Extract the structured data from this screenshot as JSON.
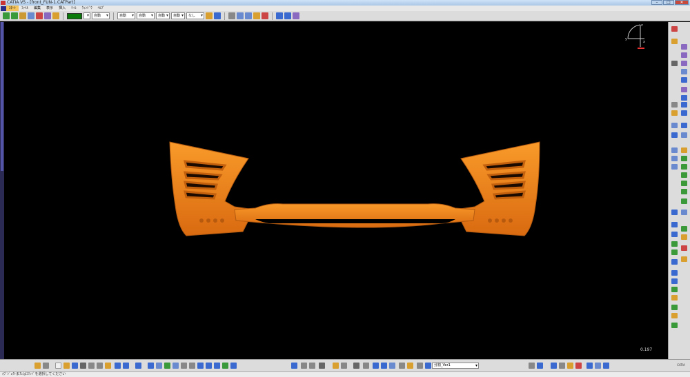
{
  "window": {
    "title": "CATIA V5 - [front_FUN-1.CATPart]",
    "controls": {
      "minimize": "–",
      "maximize": "□",
      "close": "✕"
    }
  },
  "menubar": {
    "items": [
      "ｽﾀｰﾄ",
      "ﾌｧｲﾙ",
      "編集",
      "表示",
      "挿入",
      "ﾂｰﾙ",
      "ｳｨﾝﾄﾞｳ",
      "ﾍﾙﾌﾟ"
    ]
  },
  "toolbar_top": {
    "color": "#0a7a0a",
    "combos": [
      "",
      "自動",
      "自動",
      "自動",
      "自動",
      "自動",
      "なし"
    ]
  },
  "viewport": {
    "background": "#000000",
    "model_color": "#f7891f",
    "scale_readout": "0.197"
  },
  "compass": {
    "axis_x": "x",
    "axis_y": "y",
    "axis_z": "z"
  },
  "bottom_toolbar": {
    "body_selector": "分割_Ver1"
  },
  "status_bar": {
    "text": "ｵﾌﾞｼﾞｪｸﾄまたはｺﾏﾝﾄﾞを選択してください"
  },
  "logo": {
    "text": "CATIA"
  }
}
